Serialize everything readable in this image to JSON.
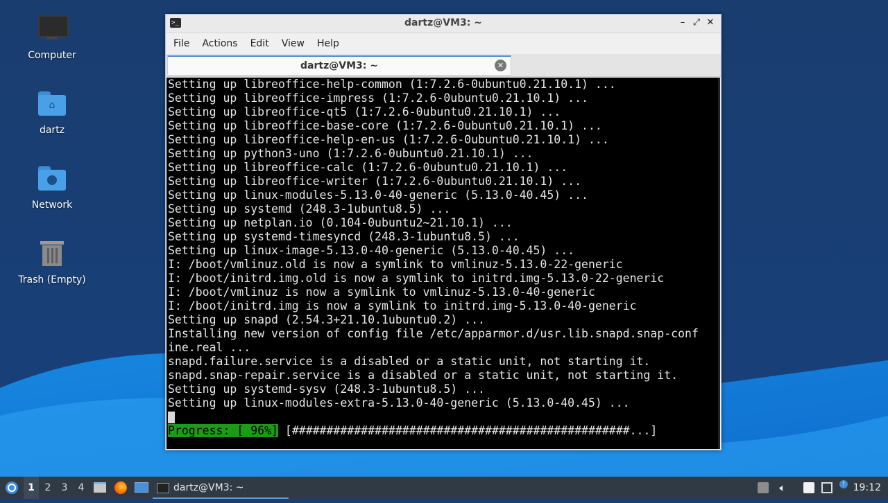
{
  "desktop": {
    "icons": [
      {
        "label": "Computer"
      },
      {
        "label": "dartz"
      },
      {
        "label": "Network"
      },
      {
        "label": "Trash (Empty)"
      }
    ]
  },
  "window": {
    "title": "dartz@VM3: ~",
    "menu": [
      "File",
      "Actions",
      "Edit",
      "View",
      "Help"
    ],
    "tab_label": "dartz@VM3: ~",
    "controls": {
      "minimize": "–",
      "maximize": "⤢",
      "close": "✕"
    }
  },
  "terminal": {
    "lines": [
      "Setting up libreoffice-help-common (1:7.2.6-0ubuntu0.21.10.1) ...",
      "Setting up libreoffice-impress (1:7.2.6-0ubuntu0.21.10.1) ...",
      "Setting up libreoffice-qt5 (1:7.2.6-0ubuntu0.21.10.1) ...",
      "Setting up libreoffice-base-core (1:7.2.6-0ubuntu0.21.10.1) ...",
      "Setting up libreoffice-help-en-us (1:7.2.6-0ubuntu0.21.10.1) ...",
      "Setting up python3-uno (1:7.2.6-0ubuntu0.21.10.1) ...",
      "Setting up libreoffice-calc (1:7.2.6-0ubuntu0.21.10.1) ...",
      "Setting up libreoffice-writer (1:7.2.6-0ubuntu0.21.10.1) ...",
      "Setting up linux-modules-5.13.0-40-generic (5.13.0-40.45) ...",
      "Setting up systemd (248.3-1ubuntu8.5) ...",
      "Setting up netplan.io (0.104-0ubuntu2~21.10.1) ...",
      "Setting up systemd-timesyncd (248.3-1ubuntu8.5) ...",
      "Setting up linux-image-5.13.0-40-generic (5.13.0-40.45) ...",
      "I: /boot/vmlinuz.old is now a symlink to vmlinuz-5.13.0-22-generic",
      "I: /boot/initrd.img.old is now a symlink to initrd.img-5.13.0-22-generic",
      "I: /boot/vmlinuz is now a symlink to vmlinuz-5.13.0-40-generic",
      "I: /boot/initrd.img is now a symlink to initrd.img-5.13.0-40-generic",
      "Setting up snapd (2.54.3+21.10.1ubuntu0.2) ...",
      "Installing new version of config file /etc/apparmor.d/usr.lib.snapd.snap-conf",
      "ine.real ...",
      "snapd.failure.service is a disabled or a static unit, not starting it.",
      "snapd.snap-repair.service is a disabled or a static unit, not starting it.",
      "Setting up systemd-sysv (248.3-1ubuntu8.5) ...",
      "Setting up linux-modules-extra-5.13.0-40-generic (5.13.0-40.45) ..."
    ],
    "progress_label": "Progress: [ 96%]",
    "progress_bar": " [#################################################...]",
    "progress_percent": 96
  },
  "taskbar": {
    "workspaces": [
      "1",
      "2",
      "3",
      "4"
    ],
    "active_workspace": "1",
    "task_label": "dartz@VM3: ~",
    "clock": "19:12"
  },
  "colors": {
    "wallpaper_dark": "#1b3f73",
    "wallpaper_wave": "#1f8fe0",
    "progress_green": "#1d9a17",
    "taskbar": "#2f3a44"
  }
}
